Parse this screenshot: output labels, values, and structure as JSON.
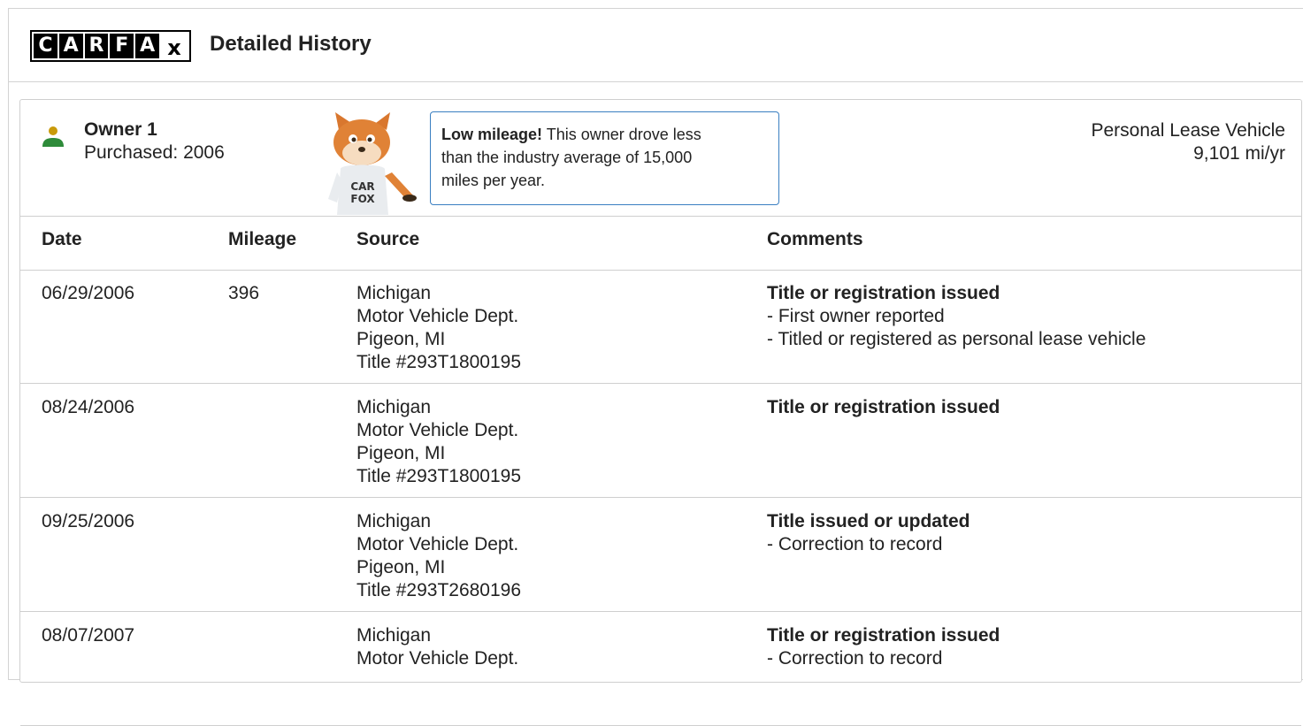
{
  "header": {
    "logo_letters": [
      "C",
      "A",
      "R",
      "F",
      "A"
    ],
    "logo_x": "x",
    "title": "Detailed History"
  },
  "owner": {
    "name": "Owner 1",
    "purchased": "Purchased: 2006",
    "icon": "person-icon",
    "icon_colors": {
      "head": "#c99a0a",
      "body": "#2e8b3a"
    }
  },
  "mascot": {
    "shirt_text": [
      "CAR",
      "FOX"
    ]
  },
  "tip": {
    "bold": "Low mileage!",
    "lines": [
      " This owner drove less",
      "than the industry average of 15,000",
      "miles per year."
    ],
    "border_color": "#3a7fc1"
  },
  "vehicle": {
    "type": "Personal Lease Vehicle",
    "mileage_rate": "9,101 mi/yr"
  },
  "table": {
    "headers": {
      "date": "Date",
      "mileage": "Mileage",
      "source": "Source",
      "comments": "Comments"
    },
    "rows": [
      {
        "date": "06/29/2006",
        "mileage": "396",
        "source": [
          "Michigan",
          "Motor Vehicle Dept.",
          "Pigeon, MI",
          "Title #293T1800195"
        ],
        "comment_title": "Title or registration issued",
        "comment_items": [
          "- First owner reported",
          "- Titled or registered as personal lease vehicle"
        ]
      },
      {
        "date": "08/24/2006",
        "mileage": "",
        "source": [
          "Michigan",
          "Motor Vehicle Dept.",
          "Pigeon, MI",
          "Title #293T1800195"
        ],
        "comment_title": "Title or registration issued",
        "comment_items": []
      },
      {
        "date": "09/25/2006",
        "mileage": "",
        "source": [
          "Michigan",
          "Motor Vehicle Dept.",
          "Pigeon, MI",
          "Title #293T2680196"
        ],
        "comment_title": "Title issued or updated",
        "comment_items": [
          "- Correction to record"
        ]
      },
      {
        "date": "08/07/2007",
        "mileage": "",
        "source": [
          "Michigan",
          "Motor Vehicle Dept."
        ],
        "comment_title": "Title or registration issued",
        "comment_items": [
          "- Correction to record"
        ]
      }
    ]
  }
}
